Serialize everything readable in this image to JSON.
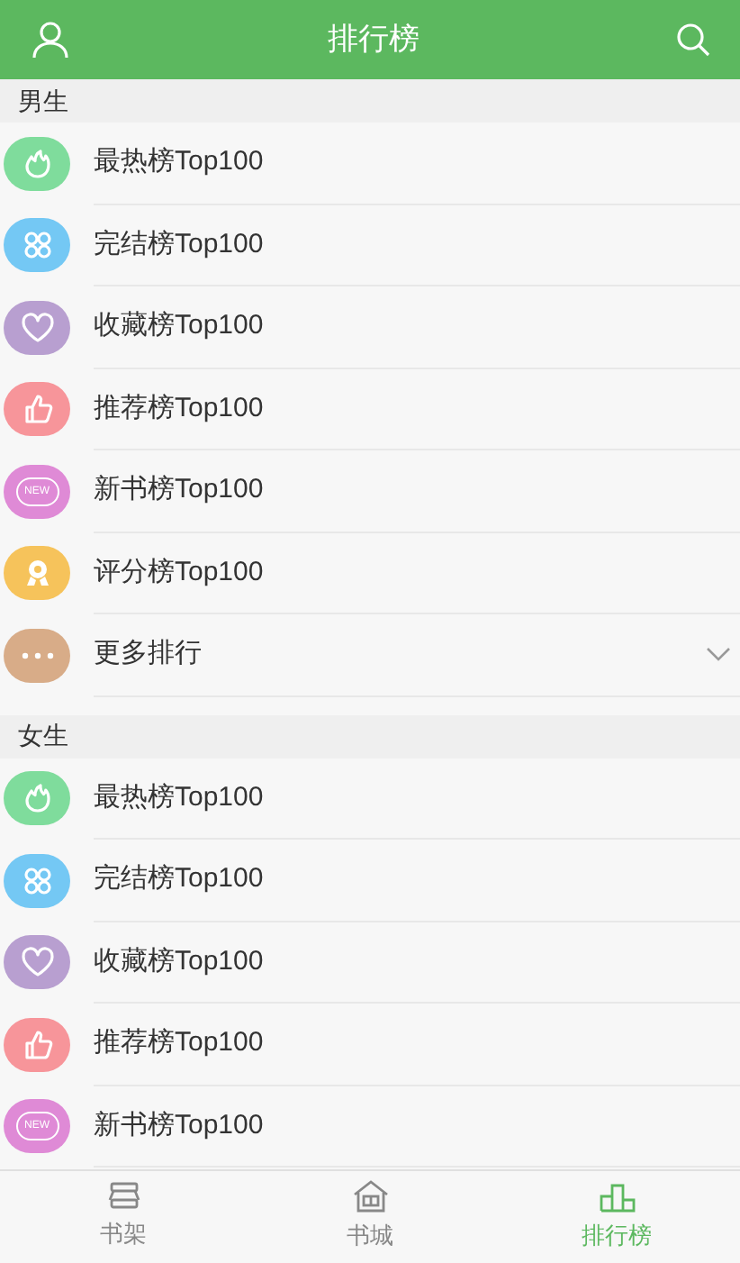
{
  "header": {
    "title": "排行榜"
  },
  "sections": [
    {
      "title": "男生",
      "items": [
        {
          "kind": "hot",
          "label": "最热榜Top100",
          "color": "#7fdc9c"
        },
        {
          "kind": "complete",
          "label": "完结榜Top100",
          "color": "#74c8f4"
        },
        {
          "kind": "favorite",
          "label": "收藏榜Top100",
          "color": "#b89fd0"
        },
        {
          "kind": "recommend",
          "label": "推荐榜Top100",
          "color": "#f7959a"
        },
        {
          "kind": "new",
          "label": "新书榜Top100",
          "color": "#df8ad6",
          "badge": "NEW"
        },
        {
          "kind": "rating",
          "label": "评分榜Top100",
          "color": "#f6c35b"
        },
        {
          "kind": "more",
          "label": "更多排行",
          "color": "#d8ac88",
          "expanded": false
        }
      ]
    },
    {
      "title": "女生",
      "items": [
        {
          "kind": "hot",
          "label": "最热榜Top100",
          "color": "#7fdc9c"
        },
        {
          "kind": "complete",
          "label": "完结榜Top100",
          "color": "#74c8f4"
        },
        {
          "kind": "favorite",
          "label": "收藏榜Top100",
          "color": "#b89fd0"
        },
        {
          "kind": "recommend",
          "label": "推荐榜Top100",
          "color": "#f7959a"
        },
        {
          "kind": "new",
          "label": "新书榜Top100",
          "color": "#df8ad6",
          "badge": "NEW"
        }
      ]
    }
  ],
  "tabs": [
    {
      "kind": "shelf",
      "label": "书架",
      "selected": false
    },
    {
      "kind": "store",
      "label": "书城",
      "selected": false
    },
    {
      "kind": "rank",
      "label": "排行榜",
      "selected": true
    }
  ]
}
